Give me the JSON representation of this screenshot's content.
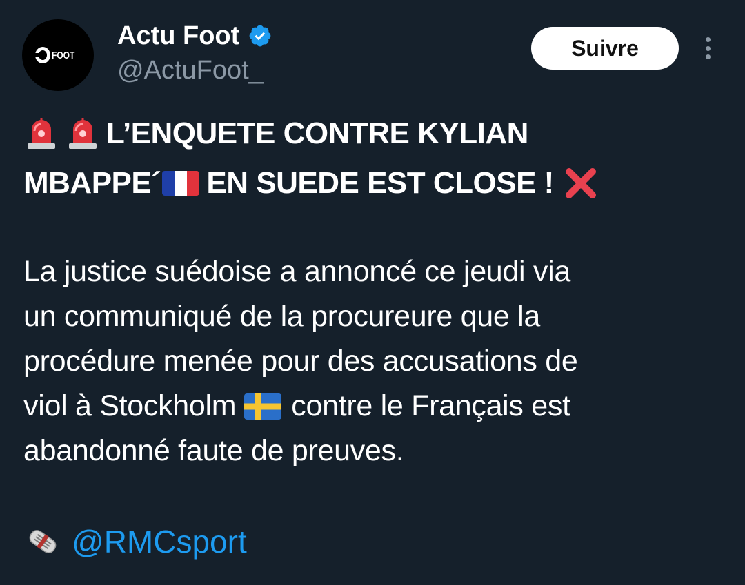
{
  "account": {
    "display_name": "Actu Foot",
    "handle": "@ActuFoot_",
    "avatar_text": "FOOT",
    "verified": true
  },
  "actions": {
    "follow_label": "Suivre"
  },
  "tweet": {
    "headline_line1": "L’ENQUETE CONTRE KYLIAN",
    "headline_line2_a": "MBAPPE´",
    "headline_line2_b": "EN SUEDE EST CLOSE !",
    "paragraph_line1": "La justice suédoise a annoncé ce jeudi via",
    "paragraph_line2": "un communiqué de la procureure que la",
    "paragraph_line3": "procédure menée pour des accusations de",
    "paragraph_line4_a": "viol à Stockholm",
    "paragraph_line4_b": "contre le Français est",
    "paragraph_line5": "abandonné faute de preuves.",
    "source_mention": "@RMCsport"
  },
  "icons": {
    "siren": "police-car-light-emoji",
    "flag_fr": "flag-france-emoji",
    "flag_se": "flag-sweden-emoji",
    "cross": "cross-mark-emoji",
    "newspaper": "rolled-newspaper-emoji",
    "verified": "verified-badge-icon",
    "more": "more-options-icon"
  },
  "colors": {
    "background": "#15202b",
    "link": "#1d9bf0",
    "secondary_text": "#8b98a5",
    "verified": "#1d9bf0"
  }
}
